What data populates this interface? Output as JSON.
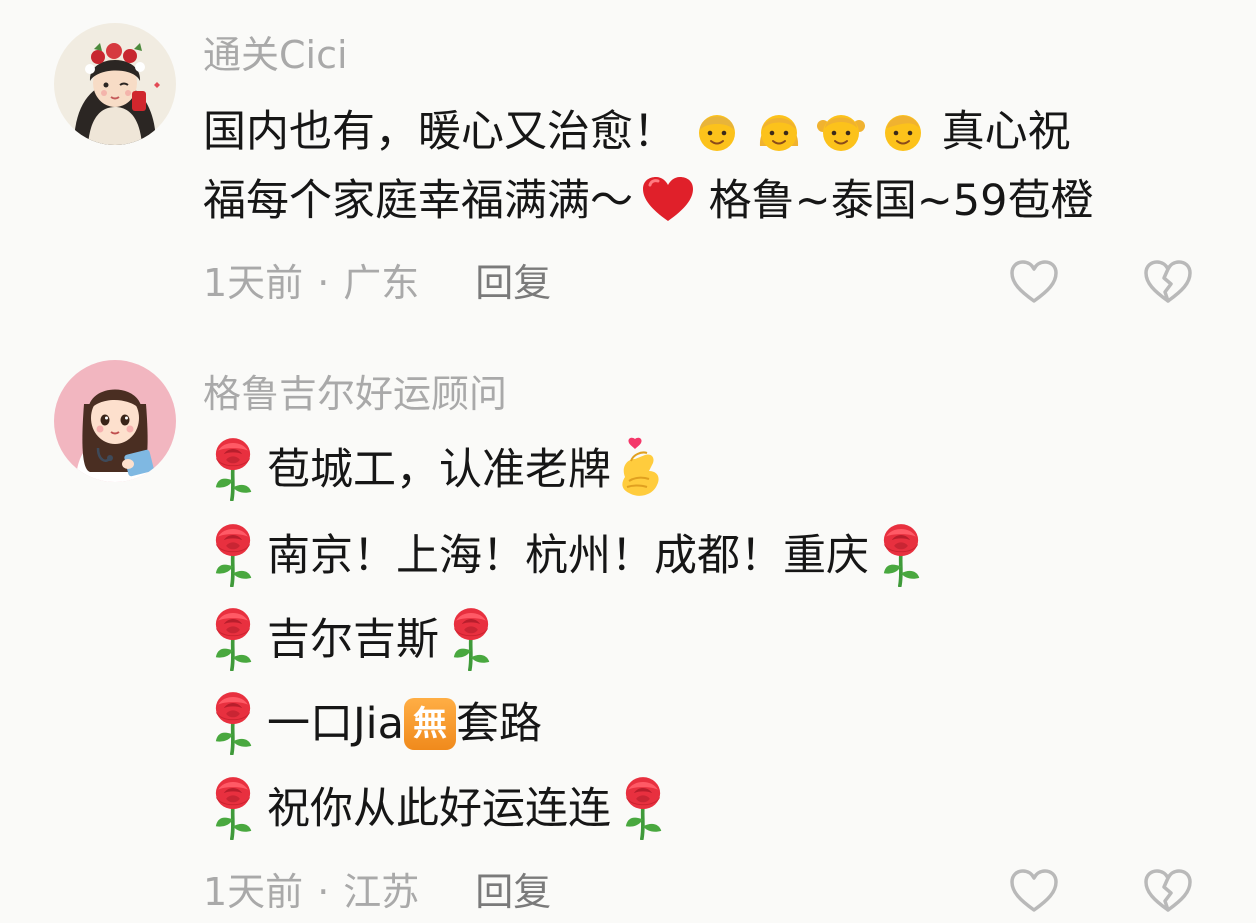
{
  "comments": [
    {
      "username": "通关Cici",
      "line1_text1": "国内也有，暖心又治愈！",
      "line1_text2": " 真心祝",
      "line2_text1": "福每个家庭幸福满满～",
      "line2_text2": " 格鲁~泰国~59苞橙",
      "time": "1天前",
      "separator": "·",
      "location": "广东",
      "reply_label": "回复",
      "emojis": [
        "man-emoji",
        "woman-emoji",
        "girl-emoji",
        "boy-emoji",
        "red-heart-emoji"
      ]
    },
    {
      "username": "格鲁吉尔好运顾问",
      "lines": [
        {
          "text": "苞城工，认准老牌"
        },
        {
          "text": "南京！上海！杭州！成都！重庆"
        },
        {
          "text": "吉尔吉斯"
        },
        {
          "text_before": "一口Jia",
          "badge": "無",
          "text_after": "套路"
        },
        {
          "text": "祝你从此好运连连"
        }
      ],
      "time": "1天前",
      "separator": "·",
      "location": "江苏",
      "reply_label": "回复",
      "emojis": [
        "rose-emoji",
        "hand-with-index-finger-and-thumb-crossed-emoji",
        "heart-emoji"
      ]
    }
  ],
  "colors": {
    "background": "#fafaf8",
    "username": "#a9a9a9",
    "content": "#161616",
    "meta": "#a9a9a9",
    "reply": "#7a7a7a",
    "icon": "#b9b9b9"
  }
}
